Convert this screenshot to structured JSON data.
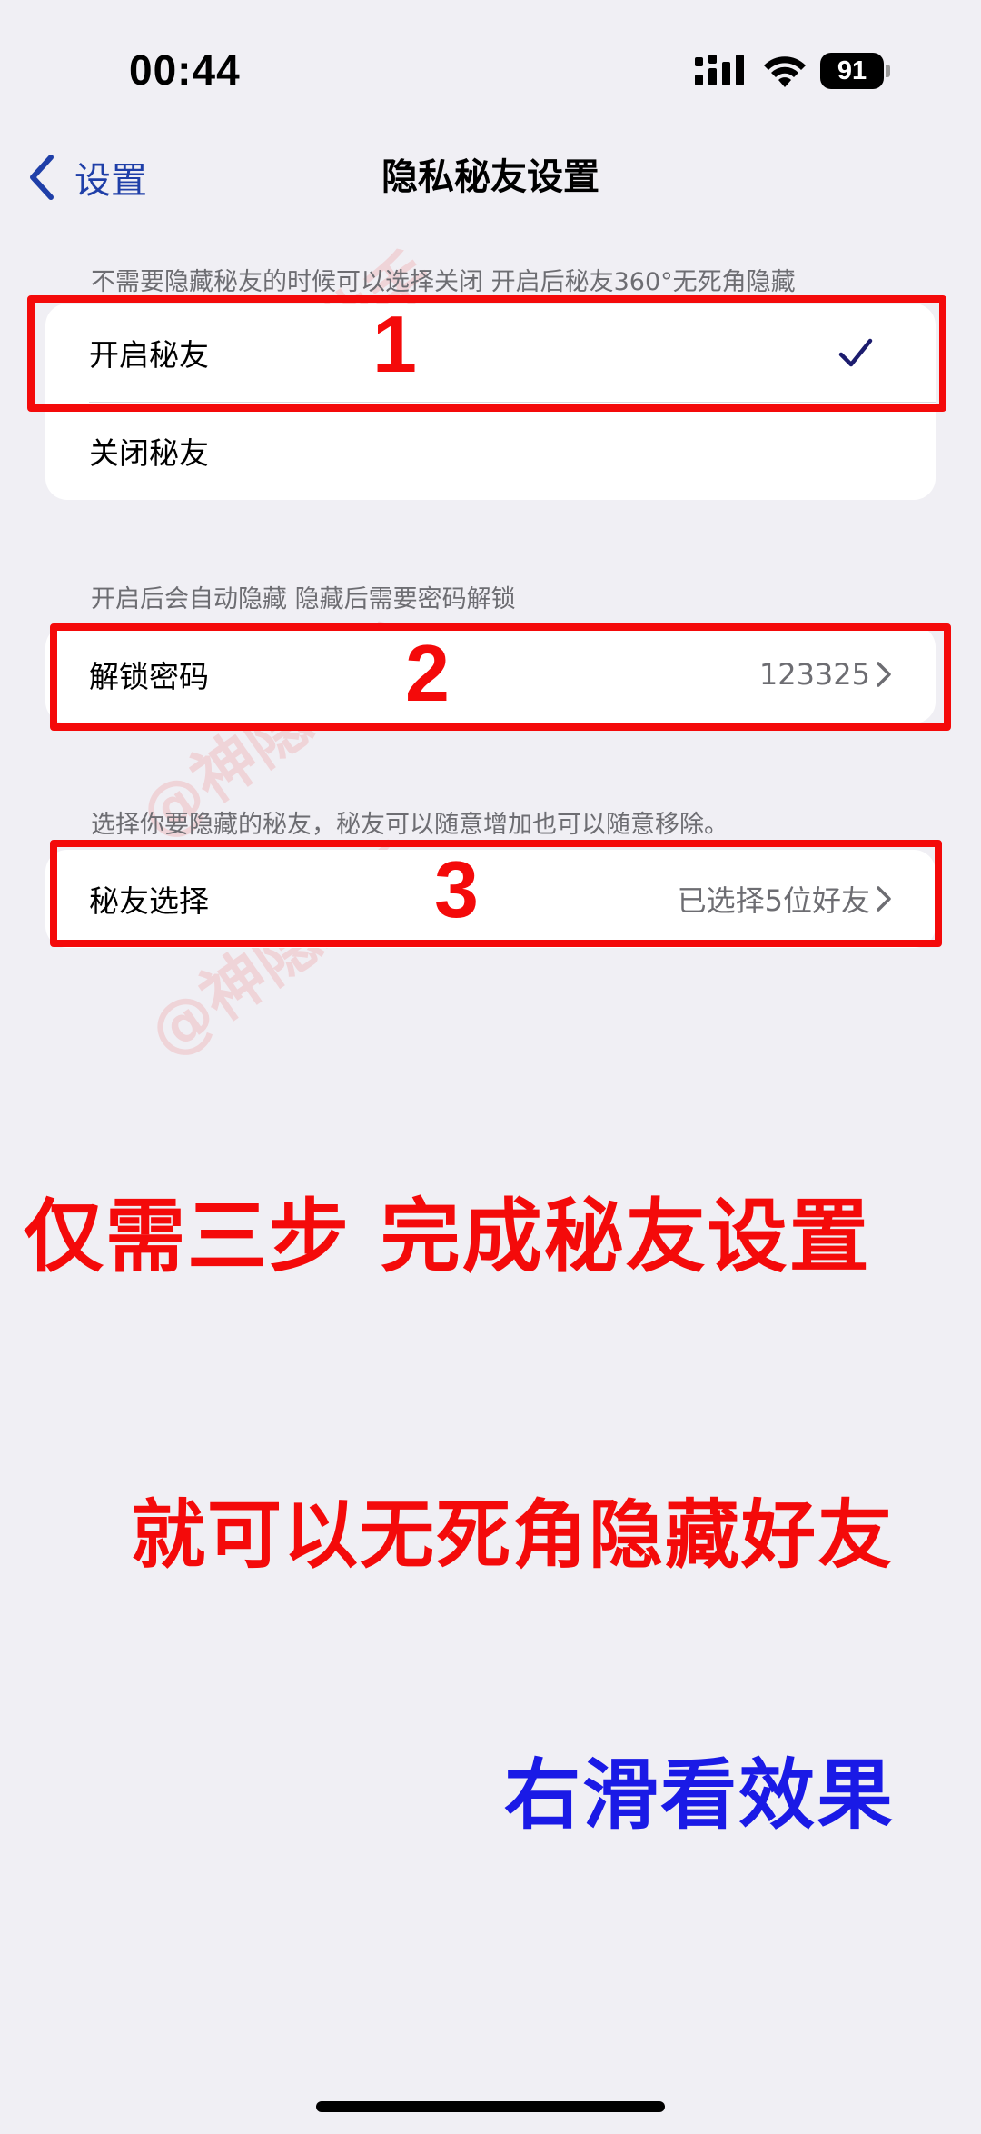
{
  "status_bar": {
    "time": "00:44",
    "battery_level": "91",
    "icons": [
      "signal-icon",
      "wifi-icon",
      "battery-icon"
    ]
  },
  "nav": {
    "back_label": "设置",
    "title": "隐私秘友设置"
  },
  "section1": {
    "note": "不需要隐藏秘友的时候可以选择关闭 开启后秘友360°无死角隐藏",
    "options": [
      {
        "label": "开启秘友",
        "selected": true
      },
      {
        "label": "关闭秘友",
        "selected": false
      }
    ]
  },
  "section2": {
    "note": "开启后会自动隐藏 隐藏后需要密码解锁",
    "row_label": "解锁密码",
    "row_value": "123325"
  },
  "section3": {
    "note": "选择你要隐藏的秘友，秘友可以随意增加也可以随意移除。",
    "row_label": "秘友选择",
    "row_value": "已选择5位好友"
  },
  "annotations": {
    "step1": "1",
    "step2": "2",
    "step3": "3",
    "highlight_color": "#f40a0a"
  },
  "watermark": "@神隐助手",
  "captions": {
    "line1": "仅需三步 完成秘友设置",
    "line2": "就可以无死角隐藏好友",
    "line3": "右滑看效果"
  },
  "colors": {
    "background": "#f0eff4",
    "accent": "#1f3fa8",
    "caption_red": "#f40a0a",
    "caption_blue": "#1a1ae6"
  }
}
